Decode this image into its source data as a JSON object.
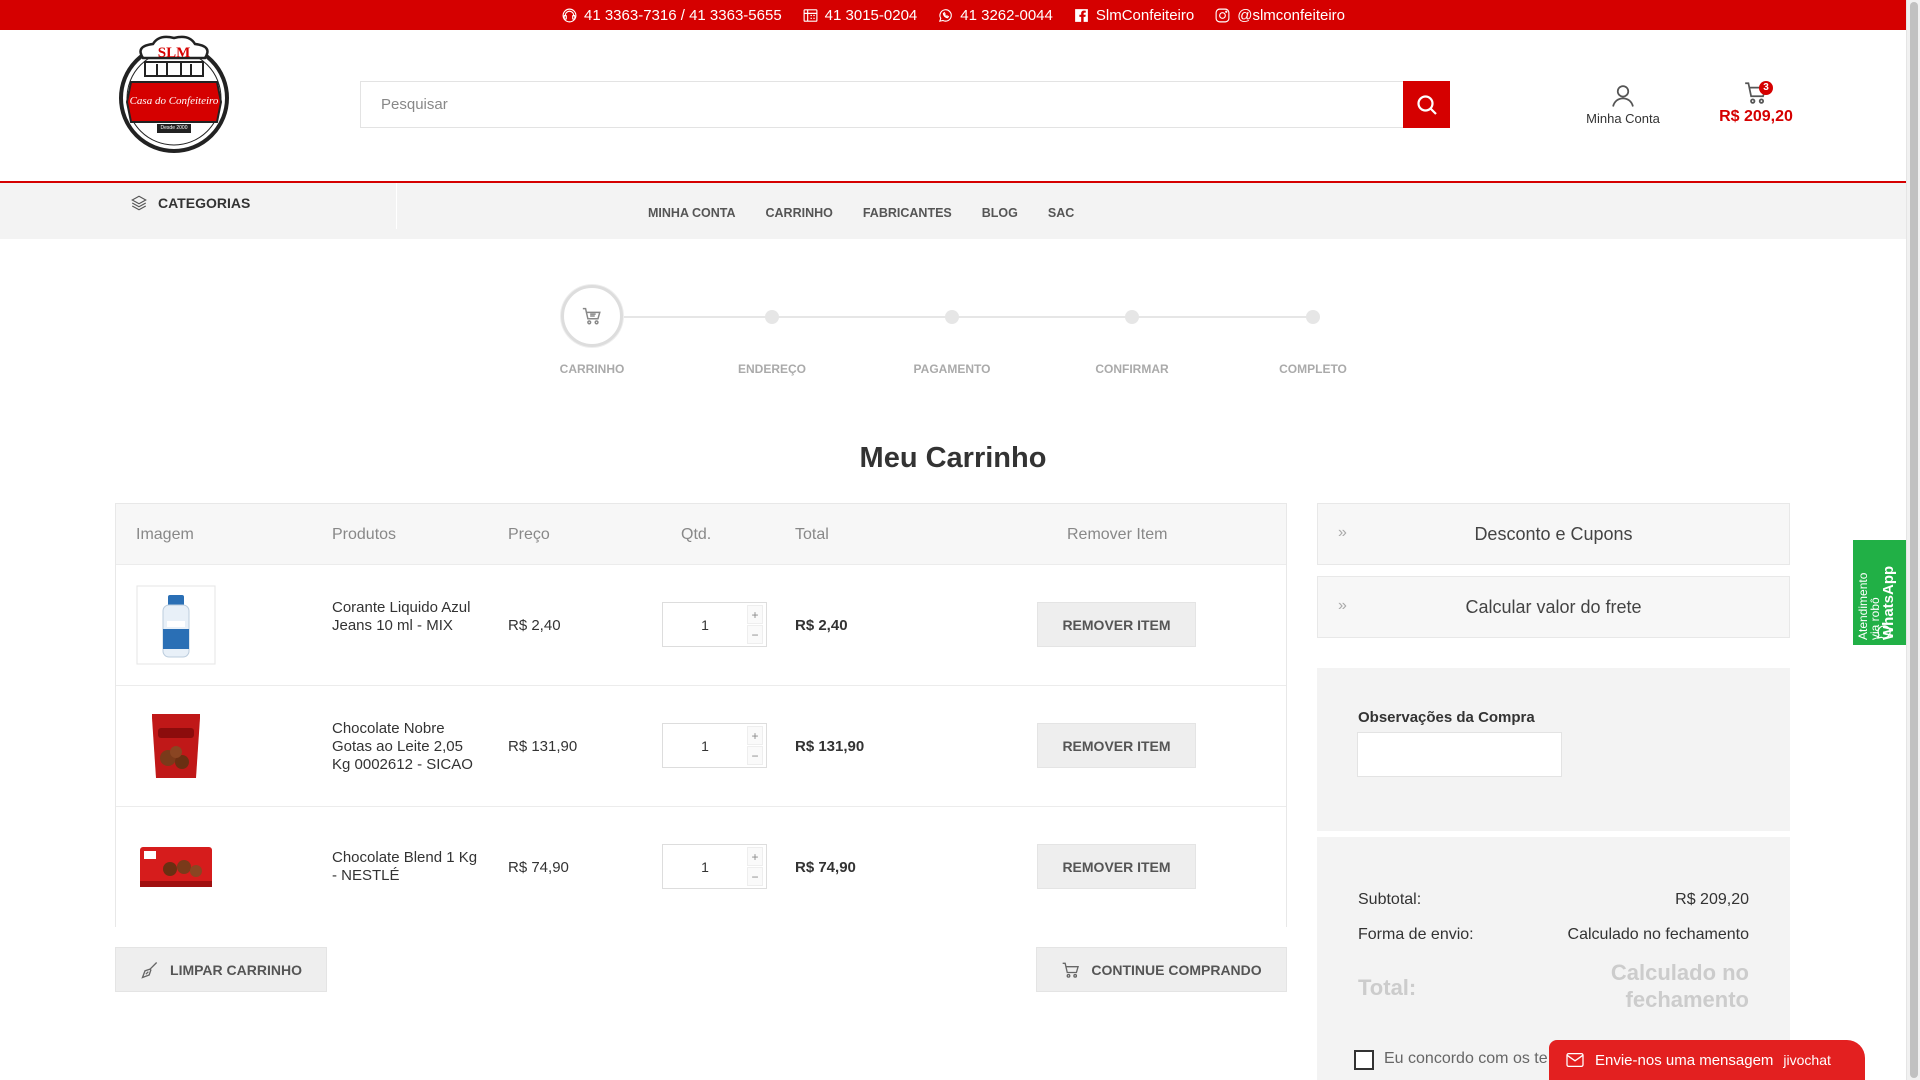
{
  "topbar": {
    "phone1": "41 3363-7316 / 41 3363-5655",
    "phone2": "41 3015-0204",
    "whatsapp": "41 3262-0044",
    "facebook": "SlmConfeiteiro",
    "instagram": "@slmconfeiteiro"
  },
  "logo": {
    "top": "SLM",
    "name": "Casa do Confeiteiro",
    "since": "Desde 2000"
  },
  "search": {
    "placeholder": "Pesquisar"
  },
  "header": {
    "account_label": "Minha Conta",
    "cart_count": "3",
    "cart_total": "R$ 209,20"
  },
  "nav": {
    "categories_label": "CATEGORIAS",
    "links": [
      "MINHA CONTA",
      "CARRINHO",
      "FABRICANTES",
      "BLOG",
      "SAC"
    ]
  },
  "steps": [
    "CARRINHO",
    "ENDEREÇO",
    "PAGAMENTO",
    "CONFIRMAR",
    "COMPLETO"
  ],
  "page_title": "Meu Carrinho",
  "table": {
    "headers": [
      "Imagem",
      "Produtos",
      "Preço",
      "Qtd.",
      "Total",
      "Remover Item"
    ],
    "rows": [
      {
        "name": "Corante Liquido Azul Jeans 10 ml - MIX",
        "price": "R$ 2,40",
        "qty": "1",
        "total": "R$ 2,40",
        "remove": "REMOVER ITEM"
      },
      {
        "name": "Chocolate Nobre Gotas ao Leite 2,05 Kg 0002612 - SICAO",
        "price": "R$ 131,90",
        "qty": "1",
        "total": "R$ 131,90",
        "remove": "REMOVER ITEM"
      },
      {
        "name": "Chocolate Blend 1 Kg - NESTLÉ",
        "price": "R$ 74,90",
        "qty": "1",
        "total": "R$ 74,90",
        "remove": "REMOVER ITEM"
      }
    ],
    "qty_plus": "+",
    "qty_minus": "−"
  },
  "actions": {
    "clear": "LIMPAR CARRINHO",
    "continue": "CONTINUE COMPRANDO"
  },
  "sidebar": {
    "discount": "Desconto e Cupons",
    "shipping": "Calcular valor do frete",
    "chevron": "»",
    "obs_label": "Observações da Compra",
    "subtotal_label": "Subtotal:",
    "subtotal_value": "R$ 209,20",
    "shipping_label": "Forma de envio:",
    "shipping_value": "Calculado no fechamento",
    "total_label": "Total:",
    "total_value": "Calculado no fechamento",
    "agree_text": "Eu concordo com os te"
  },
  "whatsapp_tab": {
    "line1": "Atendimento",
    "line2": "via robô",
    "line3": "WhatsApp"
  },
  "chat": {
    "label": "Envie-nos uma mensagem",
    "brand": "jivochat"
  },
  "colors": {
    "brand_red": "#d50000",
    "whatsapp_green": "#21b046"
  }
}
